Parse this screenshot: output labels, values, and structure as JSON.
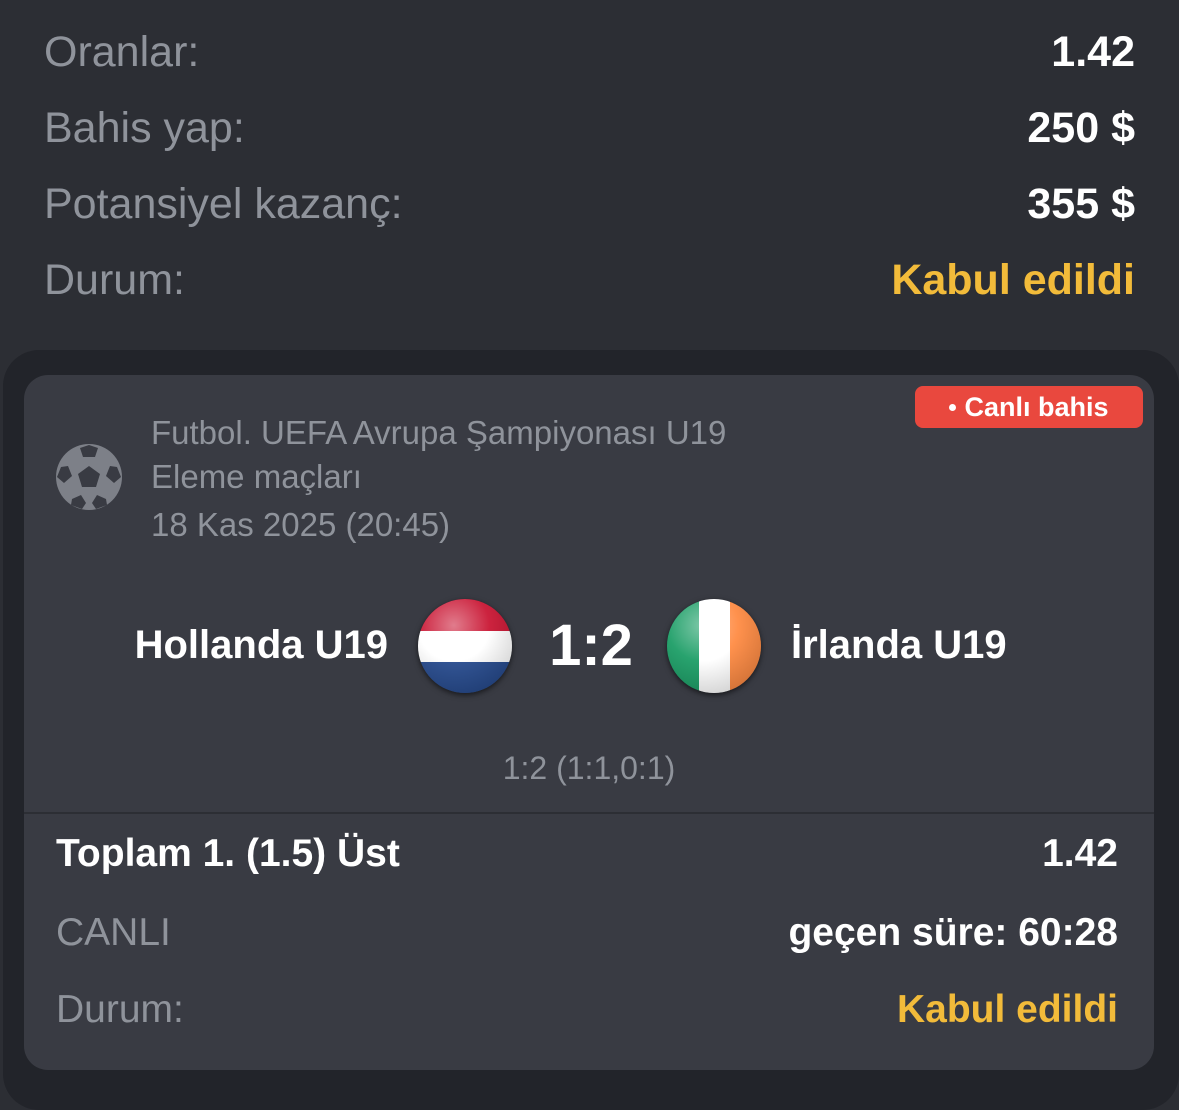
{
  "summary": {
    "odds_label": "Oranlar:",
    "odds_value": "1.42",
    "stake_label": "Bahis yap:",
    "stake_value": "250 $",
    "payout_label": "Potansiyel kazanç:",
    "payout_value": "355 $",
    "status_label": "Durum:",
    "status_value": "Kabul edildi"
  },
  "event": {
    "live_badge": "Canlı bahis",
    "sport_icon": "soccer-ball-icon",
    "league_line1": "Futbol. UEFA Avrupa Şampiyonası U19",
    "league_line2": "Eleme maçları",
    "date": "18 Kas 2025 (20:45)",
    "home_team": "Hollanda U19",
    "home_flag": "netherlands-flag-icon",
    "score": "1:2",
    "away_team": "İrlanda U19",
    "away_flag": "ireland-flag-icon",
    "score_detail": "1:2 (1:1,0:1)"
  },
  "bet": {
    "market": "Toplam 1. (1.5) Üst",
    "odds": "1.42",
    "live_label": "CANLI",
    "elapsed": "geçen süre: 60:28",
    "status_label": "Durum:",
    "status_value": "Kabul edildi"
  },
  "colors": {
    "background": "#2c2e34",
    "card": "#393b43",
    "accent": "#f2bb3a",
    "live_badge": "#e9483e",
    "muted_text": "#8f939b"
  }
}
